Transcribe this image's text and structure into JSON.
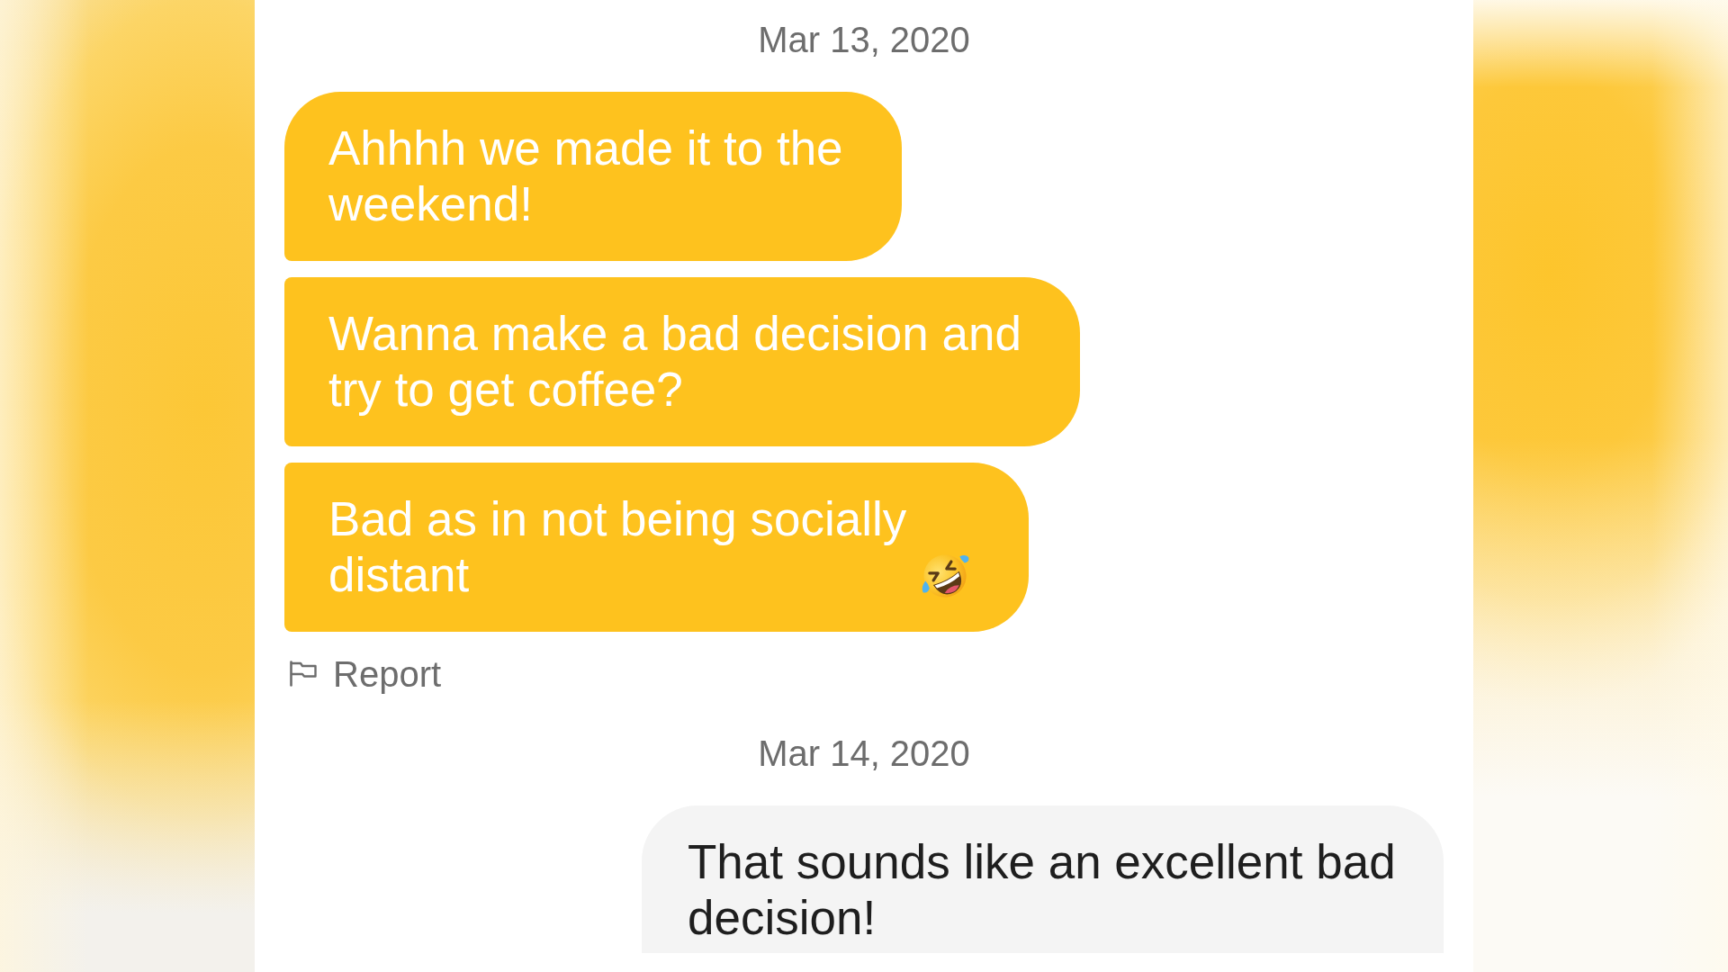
{
  "conversation": [
    {
      "kind": "date",
      "text": "Mar 13, 2020"
    },
    {
      "kind": "received",
      "text": "Ahhhh we made it to the weekend!",
      "trailing_emoji": false
    },
    {
      "kind": "received",
      "text": "Wanna make a bad decision and try to get coffee?",
      "trailing_emoji": false
    },
    {
      "kind": "received",
      "text": "Bad as in not being socially distant",
      "trailing_emoji": true
    },
    {
      "kind": "report",
      "label": "Report"
    },
    {
      "kind": "date",
      "text": "Mar 14, 2020"
    },
    {
      "kind": "sent",
      "text": "That sounds like an excellent bad decision!",
      "trailing_emoji": false
    }
  ]
}
